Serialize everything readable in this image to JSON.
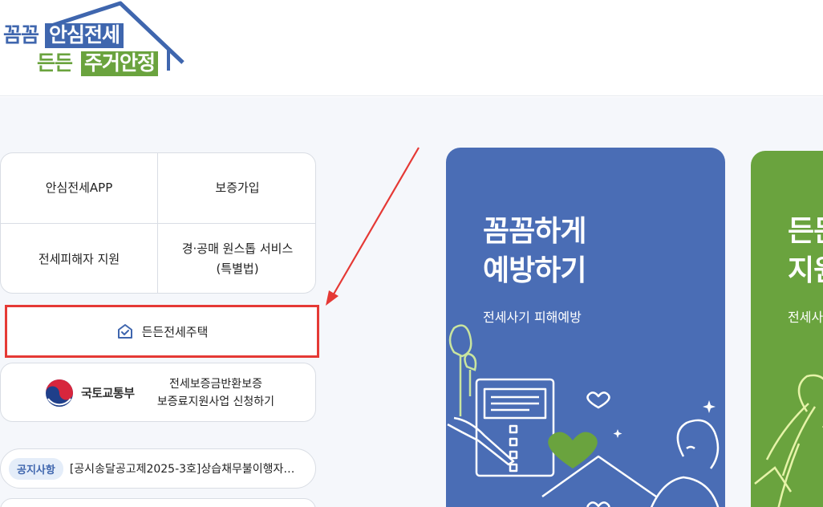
{
  "logo": {
    "line1_a": "꼼꼼",
    "line1_b": "안심전세",
    "line2_a": "든든",
    "line2_b": "주거안정"
  },
  "quick_menu": {
    "items": [
      {
        "label": "안심전세APP"
      },
      {
        "label": "보증가입"
      },
      {
        "label": "전세피해자 지원"
      },
      {
        "label_line1": "경·공매 원스톱 서비스",
        "label_line2": "(특별법)"
      }
    ]
  },
  "dd_button": {
    "label": "든든전세주택"
  },
  "molit": {
    "name": "국토교통부",
    "line1": "전세보증금반환보증",
    "line2": "보증료지원사업 신청하기"
  },
  "notice": {
    "badge": "공지사항",
    "text": "[공시송달공고제2025-3호]상습채무불이행자…"
  },
  "cards": [
    {
      "title1": "꼼꼼하게",
      "title2": "예방하기",
      "subtitle": "전세사기 피해예방"
    },
    {
      "title1": "든든",
      "title2": "지원",
      "subtitle": "전세사"
    }
  ],
  "colors": {
    "brand_blue": "#3f66ae",
    "brand_green": "#6aa33e",
    "card_blue": "#4a6db5",
    "highlight_red": "#e53935"
  }
}
